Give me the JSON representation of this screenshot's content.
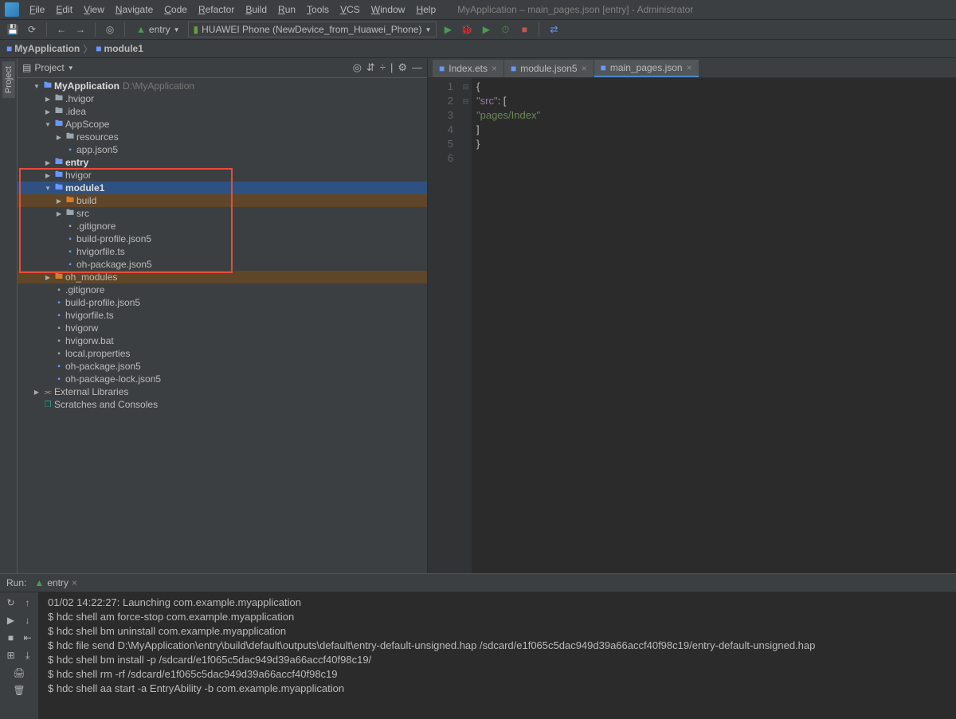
{
  "title_bar": "MyApplication – main_pages.json [entry] - Administrator",
  "menu": [
    "File",
    "Edit",
    "View",
    "Navigate",
    "Code",
    "Refactor",
    "Build",
    "Run",
    "Tools",
    "VCS",
    "Window",
    "Help"
  ],
  "toolbar": {
    "run_config": "entry",
    "device": "HUAWEI Phone (NewDevice_from_Huawei_Phone)"
  },
  "nav_bar": {
    "root": "MyApplication",
    "file": "module1"
  },
  "tree_header": {
    "mode": "Project"
  },
  "tree": {
    "items": [
      {
        "depth": 0,
        "arrow": "▼",
        "icon": "folder",
        "iconColor": "#6897ff",
        "text": "MyApplication",
        "bold": true,
        "hint": "D:\\MyApplication"
      },
      {
        "depth": 1,
        "arrow": "▶",
        "icon": "folder",
        "iconColor": "#9aa7b0",
        "text": ".hvigor"
      },
      {
        "depth": 1,
        "arrow": "▶",
        "icon": "folder",
        "iconColor": "#9aa7b0",
        "text": ".idea"
      },
      {
        "depth": 1,
        "arrow": "▼",
        "icon": "folder",
        "iconColor": "#6897ff",
        "text": "AppScope"
      },
      {
        "depth": 2,
        "arrow": "▶",
        "icon": "folder",
        "iconColor": "#9aa7b0",
        "text": "resources"
      },
      {
        "depth": 2,
        "arrow": "",
        "icon": "file",
        "iconColor": "#6897ff",
        "text": "app.json5"
      },
      {
        "depth": 1,
        "arrow": "▶",
        "icon": "folder",
        "iconColor": "#6897ff",
        "text": "entry",
        "bold": true
      },
      {
        "depth": 1,
        "arrow": "▶",
        "icon": "folder",
        "iconColor": "#6897ff",
        "text": "hvigor"
      },
      {
        "depth": 1,
        "arrow": "▼",
        "icon": "folder",
        "iconColor": "#6897ff",
        "text": "module1",
        "bold": true,
        "sel": true
      },
      {
        "depth": 2,
        "arrow": "▶",
        "icon": "folder",
        "iconColor": "#d47d30",
        "text": "build",
        "hl": true
      },
      {
        "depth": 2,
        "arrow": "▶",
        "icon": "folder",
        "iconColor": "#9aa7b0",
        "text": "src"
      },
      {
        "depth": 2,
        "arrow": "",
        "icon": "file",
        "iconColor": "#9aa7b0",
        "text": ".gitignore"
      },
      {
        "depth": 2,
        "arrow": "",
        "icon": "file",
        "iconColor": "#6897ff",
        "text": "build-profile.json5"
      },
      {
        "depth": 2,
        "arrow": "",
        "icon": "file",
        "iconColor": "#6897ff",
        "text": "hvigorfile.ts"
      },
      {
        "depth": 2,
        "arrow": "",
        "icon": "file",
        "iconColor": "#6897ff",
        "text": "oh-package.json5"
      },
      {
        "depth": 1,
        "arrow": "▶",
        "icon": "folder",
        "iconColor": "#d47d30",
        "text": "oh_modules",
        "hl": true
      },
      {
        "depth": 1,
        "arrow": "",
        "icon": "file",
        "iconColor": "#9aa7b0",
        "text": ".gitignore"
      },
      {
        "depth": 1,
        "arrow": "",
        "icon": "file",
        "iconColor": "#6897ff",
        "text": "build-profile.json5"
      },
      {
        "depth": 1,
        "arrow": "",
        "icon": "file",
        "iconColor": "#6897ff",
        "text": "hvigorfile.ts"
      },
      {
        "depth": 1,
        "arrow": "",
        "icon": "file",
        "iconColor": "#9aa7b0",
        "text": "hvigorw"
      },
      {
        "depth": 1,
        "arrow": "",
        "icon": "file",
        "iconColor": "#9aa7b0",
        "text": "hvigorw.bat"
      },
      {
        "depth": 1,
        "arrow": "",
        "icon": "file",
        "iconColor": "#9aa7b0",
        "text": "local.properties"
      },
      {
        "depth": 1,
        "arrow": "",
        "icon": "file",
        "iconColor": "#6897ff",
        "text": "oh-package.json5"
      },
      {
        "depth": 1,
        "arrow": "",
        "icon": "file",
        "iconColor": "#6897ff",
        "text": "oh-package-lock.json5"
      },
      {
        "depth": 0,
        "arrow": "▶",
        "icon": "lib",
        "iconColor": "#d19a66",
        "text": "External Libraries"
      },
      {
        "depth": 0,
        "arrow": "",
        "icon": "scratch",
        "iconColor": "#2aa198",
        "text": "Scratches and Consoles"
      }
    ]
  },
  "editor_tabs": [
    {
      "icon": "■",
      "color": "#6897ff",
      "label": "Index.ets",
      "active": false
    },
    {
      "icon": "■",
      "color": "#6897ff",
      "label": "module.json5",
      "active": false
    },
    {
      "icon": "■",
      "color": "#6897ff",
      "label": "main_pages.json",
      "active": true
    }
  ],
  "code": {
    "line_numbers": [
      "1",
      "2",
      "3",
      "4",
      "5",
      "6"
    ],
    "lines": [
      {
        "html": "{"
      },
      {
        "html": "  <span class='key'>\"src\"</span>: ["
      },
      {
        "html": "    <span class='str'>\"pages/Index\"</span>"
      },
      {
        "html": "  ]"
      },
      {
        "html": "}"
      },
      {
        "html": ""
      }
    ]
  },
  "run_tab": {
    "label": "Run:",
    "config": "entry"
  },
  "console_lines": [
    "01/02 14:22:27: Launching com.example.myapplication",
    "$ hdc shell am force-stop com.example.myapplication",
    "$ hdc shell bm uninstall com.example.myapplication",
    "$ hdc file send D:\\MyApplication\\entry\\build\\default\\outputs\\default\\entry-default-unsigned.hap /sdcard/e1f065c5dac949d39a66accf40f98c19/entry-default-unsigned.hap",
    "$ hdc shell bm install -p /sdcard/e1f065c5dac949d39a66accf40f98c19/",
    "$ hdc shell rm -rf /sdcard/e1f065c5dac949d39a66accf40f98c19",
    "$ hdc shell aa start -a EntryAbility -b com.example.myapplication"
  ]
}
